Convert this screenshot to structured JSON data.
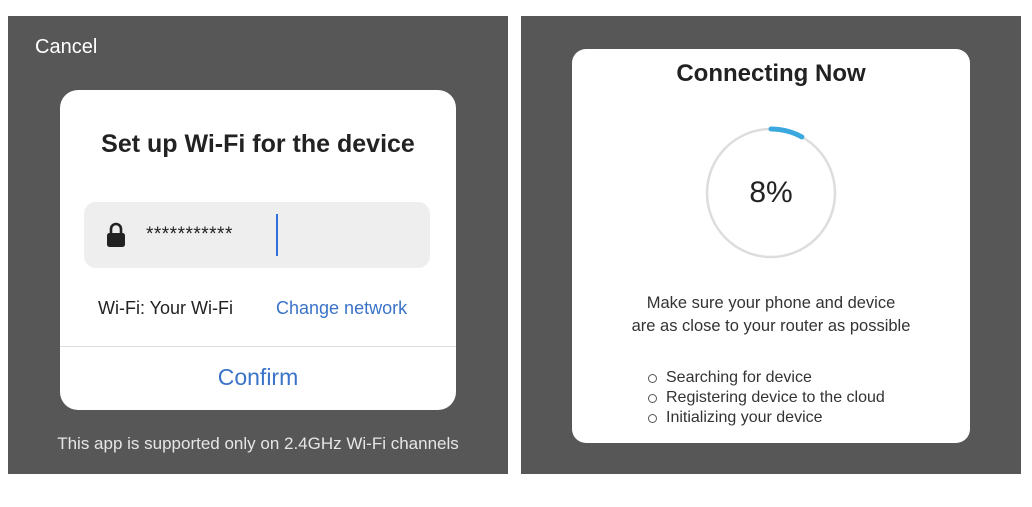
{
  "left": {
    "cancel_label": "Cancel",
    "card": {
      "title": "Set up Wi-Fi for the device",
      "password_value": "***********",
      "wifi_label": "Wi-Fi: Your Wi-Fi",
      "change_network_label": "Change network",
      "confirm_label": "Confirm"
    },
    "support_note": "This app is supported only on 2.4GHz Wi-Fi channels",
    "icons": {
      "lock": "lock-icon"
    }
  },
  "right": {
    "title": "Connecting Now",
    "progress": {
      "value": 8,
      "label": "8%"
    },
    "hint_lines": [
      "Make sure your phone and device",
      "are as close to your router as possible"
    ],
    "steps": [
      "Searching for device",
      "Registering device to the cloud",
      "Initializing your device"
    ]
  },
  "colors": {
    "backdrop": "#575757",
    "link": "#3a73c8",
    "progress_arc": "#3aa8df",
    "progress_track": "#dddddd"
  }
}
